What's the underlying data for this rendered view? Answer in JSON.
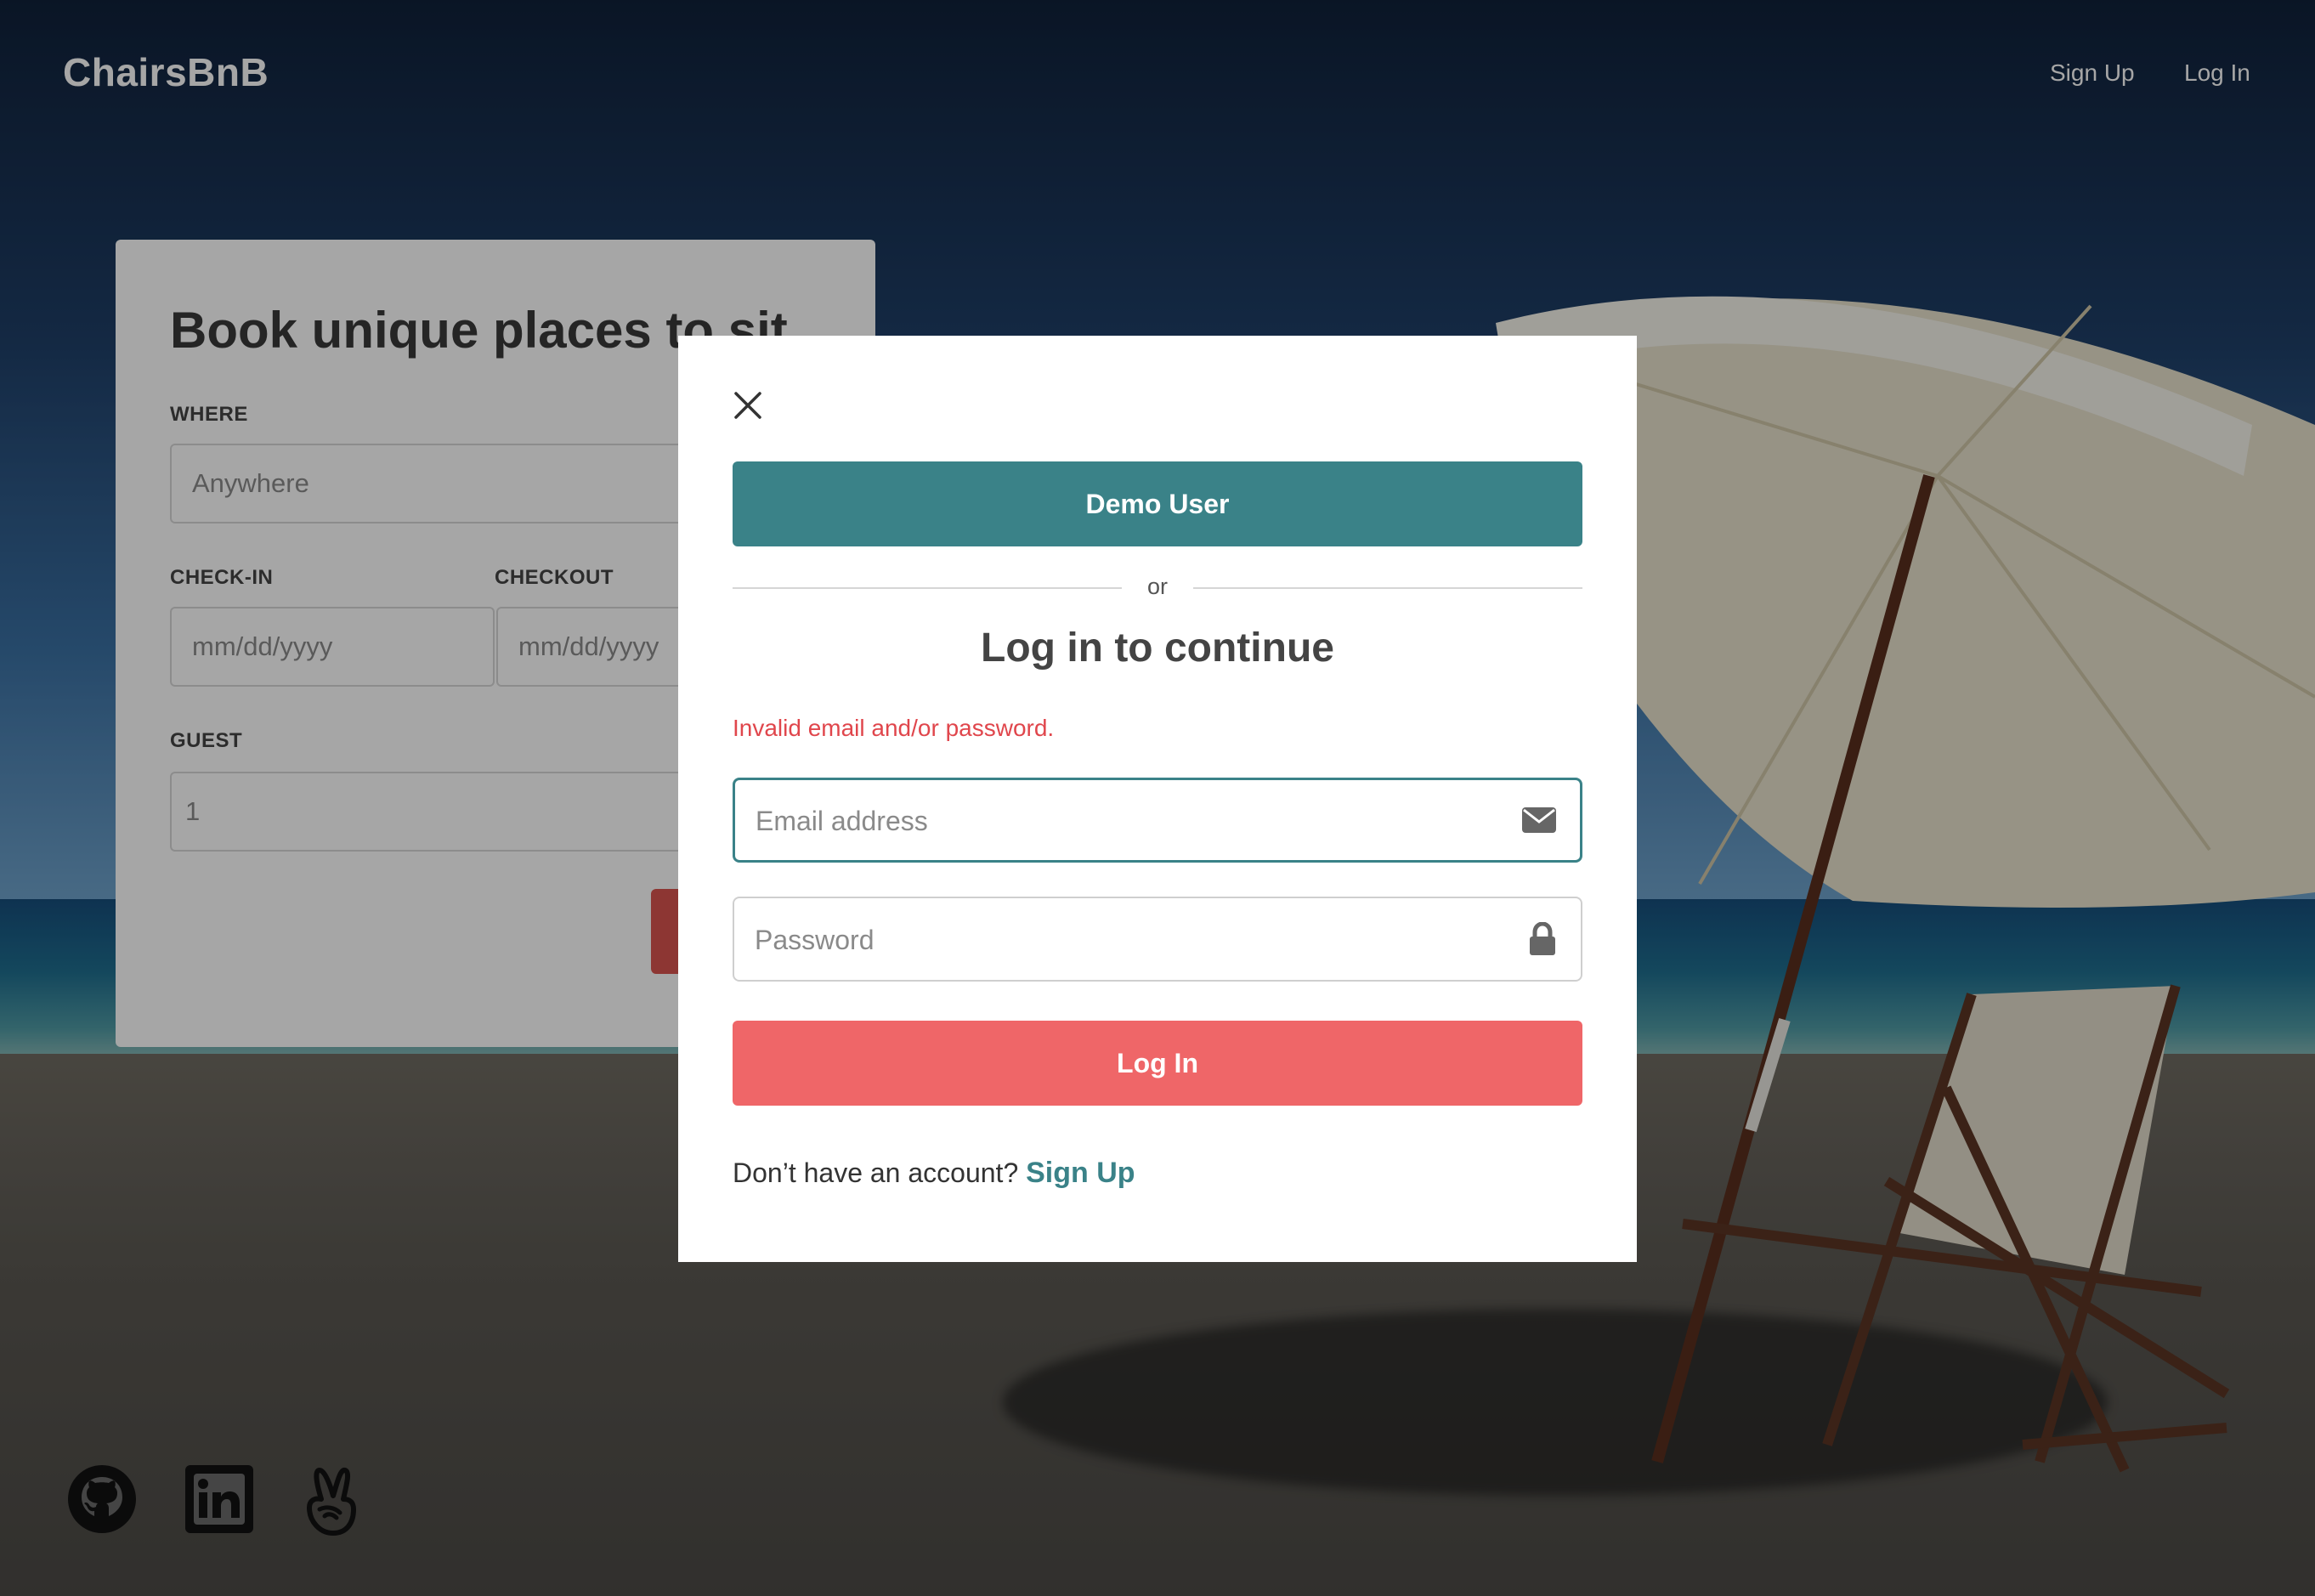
{
  "header": {
    "brand": "ChairsBnB",
    "nav": {
      "signup": "Sign Up",
      "login": "Log In"
    }
  },
  "booking": {
    "title": "Book unique places to sit",
    "where_label": "WHERE",
    "where_placeholder": "Anywhere",
    "checkin_label": "CHECK-IN",
    "checkin_placeholder": "mm/dd/yyyy",
    "checkout_label": "CHECKOUT",
    "checkout_placeholder": "mm/dd/yyyy",
    "guest_label": "GUEST",
    "guest_value": "1"
  },
  "modal": {
    "demo_button": "Demo User",
    "divider": "or",
    "title": "Log in to continue",
    "error": "Invalid email and/or password.",
    "email_placeholder": "Email address",
    "password_placeholder": "Password",
    "login_button": "Log In",
    "no_account_text": "Don’t have an account?",
    "signup_link": "Sign Up"
  },
  "footer": {
    "icons": [
      "github-icon",
      "linkedin-icon",
      "angellist-icon"
    ]
  },
  "colors": {
    "teal": "#3a8288",
    "coral": "#ef6668",
    "error": "#e0464c"
  }
}
